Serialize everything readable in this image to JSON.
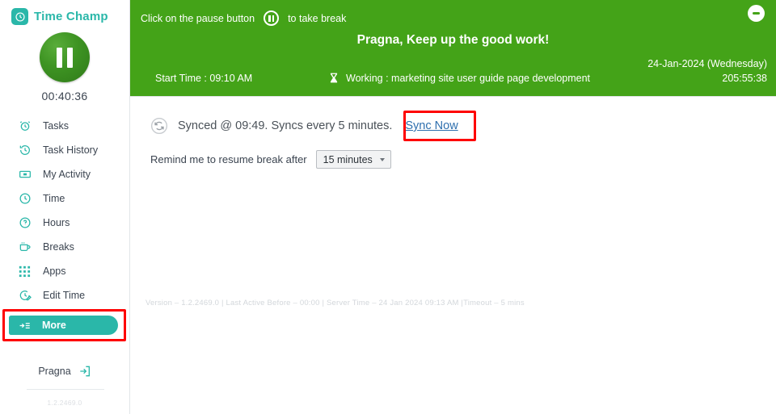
{
  "sidebar": {
    "brand": {
      "name": "Time Champ",
      "icon": "clock-icon"
    },
    "timer": {
      "value": "00:40:36",
      "pause_icon": "pause-icon"
    },
    "items": [
      {
        "label": "Tasks",
        "icon": "alarm-clock-icon"
      },
      {
        "label": "Task History",
        "icon": "history-clock-icon"
      },
      {
        "label": "My Activity",
        "icon": "activity-ticket-icon"
      },
      {
        "label": "Time",
        "icon": "clock-icon"
      },
      {
        "label": "Hours",
        "icon": "question-clock-icon"
      },
      {
        "label": "Breaks",
        "icon": "coffee-cup-icon"
      },
      {
        "label": "Apps",
        "icon": "grid-dots-icon"
      },
      {
        "label": "Edit Time",
        "icon": "edit-clock-icon"
      }
    ],
    "more": {
      "label": "More",
      "icon": "menu-arrow-icon"
    },
    "user": {
      "name": "Pragna",
      "logout_icon": "logout-icon"
    },
    "version": "1.2.2469.0"
  },
  "banner": {
    "hint_prefix": "Click on the pause button",
    "hint_suffix": "to take break",
    "pause_icon": "pause-circle-icon",
    "minimize_icon": "minimize-icon",
    "greeting": "Pragna, Keep up the good work!",
    "start_time": "Start Time : 09:10 AM",
    "working_icon": "hourglass-icon",
    "working": "Working : marketing site user guide page development",
    "date": "24-Jan-2024 (Wednesday)",
    "total_hours": "205:55:38"
  },
  "content": {
    "sync_icon": "sync-refresh-icon",
    "sync_text": "Synced @ 09:49. Syncs every 5 minutes.",
    "sync_now_label": "Sync Now",
    "remind_label": "Remind me to resume break after",
    "remind_value": "15 minutes",
    "footer": "Version – 1.2.2469.0 | Last Active Before – 00:00 | Server Time – 24 Jan 2024 09:13 AM |Timeout – 5 mins"
  },
  "colors": {
    "banner_green": "#44a318",
    "teal": "#2ab7a9",
    "highlight_red": "#fe0000",
    "link_blue": "#2e6fae"
  }
}
